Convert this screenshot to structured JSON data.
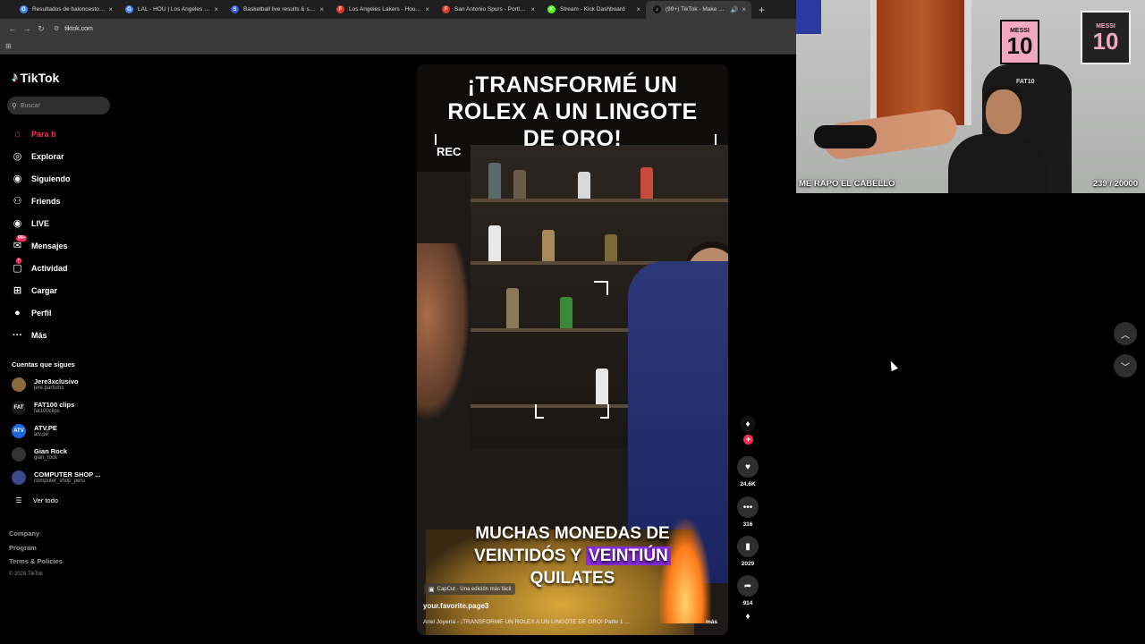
{
  "browser": {
    "tabs": [
      {
        "title": "Resultados de baloncesto en vivo",
        "icon": "google-icon",
        "color": "#4285f4",
        "glyph": "G",
        "active": false
      },
      {
        "title": "LAL - HOU | Los Angeles Lakers",
        "icon": "google-icon",
        "color": "#4285f4",
        "glyph": "G",
        "active": false
      },
      {
        "title": "Basketball live results & schedule",
        "icon": "flashscore-icon",
        "color": "#3a5bd9",
        "glyph": "S",
        "active": false
      },
      {
        "title": "Los Angeles Lakers - Houston R",
        "icon": "flashscore-icon",
        "color": "#d93a2a",
        "glyph": "F",
        "active": false
      },
      {
        "title": "San Antonio Spurs - Portland T",
        "icon": "flashscore-icon",
        "color": "#d93a2a",
        "glyph": "F",
        "active": false
      },
      {
        "title": "Stream - Kick Dashboard",
        "icon": "kick-icon",
        "color": "#53fc18",
        "glyph": "K",
        "active": false
      },
      {
        "title": "(99+) TikTok - Make Your Day",
        "icon": "tiktok-icon",
        "color": "#111111",
        "glyph": "♪",
        "active": true
      }
    ],
    "new_tab_glyph": "+",
    "url": "tiktok.com"
  },
  "sidebar": {
    "logo": "TikTok",
    "search_placeholder": "Buscar",
    "nav": [
      {
        "label": "Para ti",
        "icon": "home-icon",
        "glyph": "⌂",
        "active": true,
        "badge": ""
      },
      {
        "label": "Explorar",
        "icon": "compass-icon",
        "glyph": "◎",
        "active": false,
        "badge": ""
      },
      {
        "label": "Siguiendo",
        "icon": "following-icon",
        "glyph": "◉",
        "active": false,
        "badge": ""
      },
      {
        "label": "Friends",
        "icon": "friends-icon",
        "glyph": "⚇",
        "active": false,
        "badge": ""
      },
      {
        "label": "LIVE",
        "icon": "live-icon",
        "glyph": "◉",
        "active": false,
        "badge": ""
      },
      {
        "label": "Mensajes",
        "icon": "messages-icon",
        "glyph": "✉",
        "active": false,
        "badge": "99+"
      },
      {
        "label": "Actividad",
        "icon": "activity-icon",
        "glyph": "▢",
        "active": false,
        "badge": "•"
      },
      {
        "label": "Cargar",
        "icon": "upload-icon",
        "glyph": "⊞",
        "active": false,
        "badge": ""
      },
      {
        "label": "Perfil",
        "icon": "profile-icon",
        "glyph": "●",
        "active": false,
        "badge": ""
      },
      {
        "label": "Más",
        "icon": "more-icon",
        "glyph": "···",
        "active": false,
        "badge": ""
      }
    ],
    "following_title": "Cuentas que sigues",
    "following": [
      {
        "name": "Jere3xclusivo",
        "handle": "jere.parfums",
        "color": "#8a6a3a",
        "glyph": ""
      },
      {
        "name": "FAT100 clips",
        "handle": "fat100clips",
        "color": "#1a1a1a",
        "glyph": "FAT"
      },
      {
        "name": "ATV.PE",
        "handle": "atv.pe",
        "color": "#1a6ad8",
        "glyph": "ATV"
      },
      {
        "name": "Gian Rock",
        "handle": "gian_rock",
        "color": "#333333",
        "glyph": ""
      },
      {
        "name": "COMPUTER SHOP ...",
        "handle": "computer_shop_peru",
        "color": "#3a4a8a",
        "glyph": ""
      }
    ],
    "see_all": "Ver todo",
    "footer": [
      "Company",
      "Program",
      "Terms & Policies"
    ],
    "copyright": "© 2026 TikTok"
  },
  "video": {
    "title_lines": [
      "¡TRANSFORMÉ UN",
      "ROLEX A UN LINGOTE",
      "DE ORO!"
    ],
    "rec_label": "REC",
    "caption_line1": "MUCHAS MONEDAS DE",
    "caption_line2_a": "VEINTIDÓS Y",
    "caption_line2_b": "VEINTIÚN",
    "caption_line3": "QUILATES",
    "capcut_label": "CapCut · Una edición más fácil",
    "author": "your.favorite.page3",
    "description": "Ariel Joyería - ¡TRANSFORMÉ UN ROLEX A UN LINGOTE DE ORO! Parte 1 ...",
    "more_label": "más"
  },
  "actions": {
    "likes": "24.6K",
    "comments": "316",
    "saves": "2029",
    "shares": "914"
  },
  "webcam": {
    "caption": "ME RAPO EL CABELLO",
    "count": "239 / 20000",
    "poster1_name": "MESSI",
    "poster1_num": "10",
    "poster2_name": "MESSI",
    "poster2_num": "10",
    "chair_logo": "FAT10"
  },
  "colors": {
    "accent": "#fe2c55",
    "background": "#000000",
    "chrome": "#3a3a3a"
  }
}
